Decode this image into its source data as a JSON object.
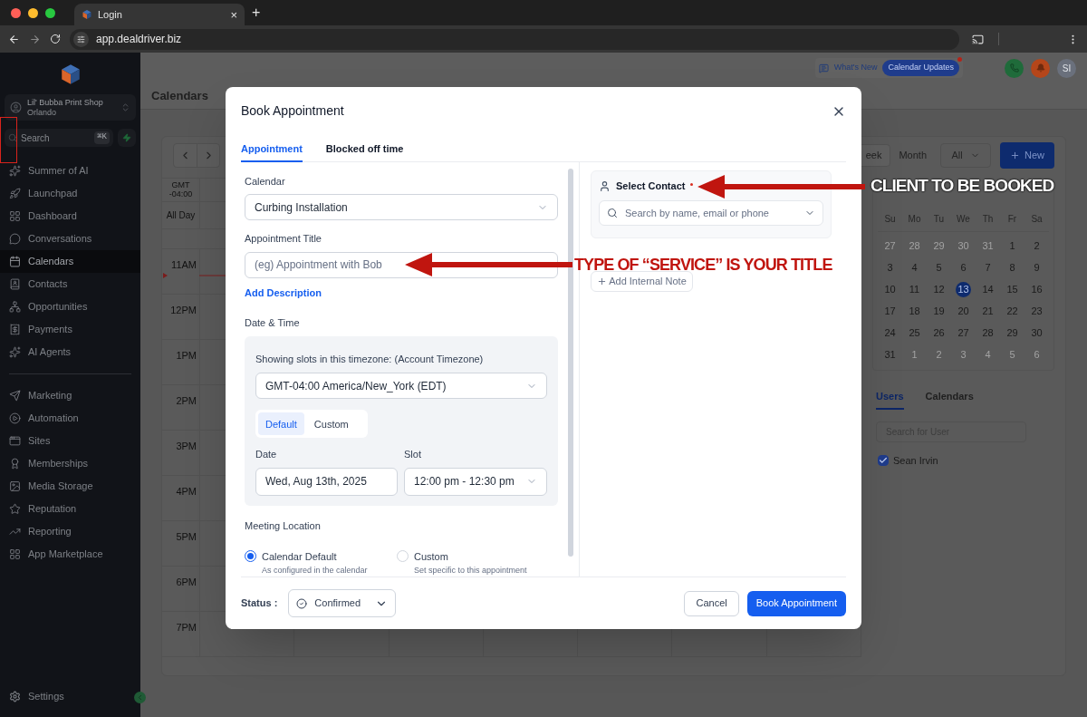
{
  "browser": {
    "tab_title": "Login",
    "tab_close": "×",
    "new_tab": "+",
    "url": "app.dealdriver.biz"
  },
  "sidebar": {
    "account": {
      "name": "Lil' Bubba Print Shop",
      "location": "Orlando"
    },
    "search": {
      "placeholder": "Search",
      "shortcut": "⌘K"
    },
    "items": [
      {
        "label": "Summer of AI",
        "selected": false
      },
      {
        "label": "Launchpad",
        "selected": false
      },
      {
        "label": "Dashboard",
        "selected": false
      },
      {
        "label": "Conversations",
        "selected": false
      },
      {
        "label": "Calendars",
        "selected": true
      },
      {
        "label": "Contacts",
        "selected": false
      },
      {
        "label": "Opportunities",
        "selected": false
      },
      {
        "label": "Payments",
        "selected": false
      },
      {
        "label": "AI Agents",
        "selected": false
      }
    ],
    "items_2": [
      {
        "label": "Marketing",
        "selected": false
      },
      {
        "label": "Automation",
        "selected": false
      },
      {
        "label": "Sites",
        "selected": false
      },
      {
        "label": "Memberships",
        "selected": false
      },
      {
        "label": "Media Storage",
        "selected": false
      },
      {
        "label": "Reputation",
        "selected": false
      },
      {
        "label": "Reporting",
        "selected": false
      },
      {
        "label": "App Marketplace",
        "selected": false
      }
    ],
    "settings": "Settings"
  },
  "header": {
    "whats_new": "What's New",
    "badge": "Calendar Updates",
    "badge_unread": true,
    "avatar": "SI"
  },
  "page": {
    "title": "Calendars"
  },
  "toolbar": {
    "views": [
      {
        "label": "eek",
        "selected": true
      },
      {
        "label": "Month",
        "selected": false
      }
    ],
    "filter": "All",
    "new_button": "New"
  },
  "grid": {
    "timezone": "GMT -04:00",
    "all_day": "All Day",
    "hours": [
      "11AM",
      "12PM",
      "1PM",
      "2PM",
      "3PM",
      "4PM",
      "5PM",
      "6PM",
      "7PM"
    ]
  },
  "mini_calendar": {
    "weekdays": [
      "Su",
      "Mo",
      "Tu",
      "We",
      "Th",
      "Fr",
      "Sa"
    ],
    "days": [
      {
        "label": "27",
        "muted": true,
        "selected": false
      },
      {
        "label": "28",
        "muted": true,
        "selected": false
      },
      {
        "label": "29",
        "muted": true,
        "selected": false
      },
      {
        "label": "30",
        "muted": true,
        "selected": false
      },
      {
        "label": "31",
        "muted": true,
        "selected": false
      },
      {
        "label": "1",
        "muted": false,
        "selected": false
      },
      {
        "label": "2",
        "muted": false,
        "selected": false
      },
      {
        "label": "3",
        "muted": false,
        "selected": false
      },
      {
        "label": "4",
        "muted": false,
        "selected": false
      },
      {
        "label": "5",
        "muted": false,
        "selected": false
      },
      {
        "label": "6",
        "muted": false,
        "selected": false
      },
      {
        "label": "7",
        "muted": false,
        "selected": false
      },
      {
        "label": "8",
        "muted": false,
        "selected": false
      },
      {
        "label": "9",
        "muted": false,
        "selected": false
      },
      {
        "label": "10",
        "muted": false,
        "selected": false
      },
      {
        "label": "11",
        "muted": false,
        "selected": false
      },
      {
        "label": "12",
        "muted": false,
        "selected": false
      },
      {
        "label": "13",
        "muted": false,
        "selected": true
      },
      {
        "label": "14",
        "muted": false,
        "selected": false
      },
      {
        "label": "15",
        "muted": false,
        "selected": false
      },
      {
        "label": "16",
        "muted": false,
        "selected": false
      },
      {
        "label": "17",
        "muted": false,
        "selected": false
      },
      {
        "label": "18",
        "muted": false,
        "selected": false
      },
      {
        "label": "19",
        "muted": false,
        "selected": false
      },
      {
        "label": "20",
        "muted": false,
        "selected": false
      },
      {
        "label": "21",
        "muted": false,
        "selected": false
      },
      {
        "label": "22",
        "muted": false,
        "selected": false
      },
      {
        "label": "23",
        "muted": false,
        "selected": false
      },
      {
        "label": "24",
        "muted": false,
        "selected": false
      },
      {
        "label": "25",
        "muted": false,
        "selected": false
      },
      {
        "label": "26",
        "muted": false,
        "selected": false
      },
      {
        "label": "27",
        "muted": false,
        "selected": false
      },
      {
        "label": "28",
        "muted": false,
        "selected": false
      },
      {
        "label": "29",
        "muted": false,
        "selected": false
      },
      {
        "label": "30",
        "muted": false,
        "selected": false
      },
      {
        "label": "31",
        "muted": false,
        "selected": false
      },
      {
        "label": "1",
        "muted": true,
        "selected": false
      },
      {
        "label": "2",
        "muted": true,
        "selected": false
      },
      {
        "label": "3",
        "muted": true,
        "selected": false
      },
      {
        "label": "4",
        "muted": true,
        "selected": false
      },
      {
        "label": "5",
        "muted": true,
        "selected": false
      },
      {
        "label": "6",
        "muted": true,
        "selected": false
      }
    ]
  },
  "users_panel": {
    "tabs": [
      {
        "label": "Users",
        "selected": true
      },
      {
        "label": "Calendars",
        "selected": false
      }
    ],
    "search_placeholder": "Search for User",
    "users": [
      {
        "name": "Sean Irvin",
        "checked": true
      }
    ]
  },
  "modal": {
    "title": "Book Appointment",
    "tabs": [
      {
        "label": "Appointment",
        "selected": true
      },
      {
        "label": "Blocked off time",
        "selected": false
      }
    ],
    "calendar_label": "Calendar",
    "calendar_value": "Curbing Installation",
    "title_label": "Appointment Title",
    "title_placeholder": "(eg) Appointment with Bob",
    "add_description": "Add Description",
    "datetime_label": "Date & Time",
    "timezone_note": "Showing slots in this timezone: (Account Timezone)",
    "timezone_value": "GMT-04:00 America/New_York (EDT)",
    "slot_modes": [
      {
        "label": "Default",
        "selected": true
      },
      {
        "label": "Custom",
        "selected": false
      }
    ],
    "date_label": "Date",
    "date_value": "Wed, Aug 13th, 2025",
    "slot_label": "Slot",
    "slot_value": "12:00 pm - 12:30 pm",
    "location_label": "Meeting Location",
    "locations": [
      {
        "label": "Calendar Default",
        "hint": "As configured in the calendar",
        "selected": true
      },
      {
        "label": "Custom",
        "hint": "Set specific to this appointment",
        "selected": false
      }
    ],
    "contact_label": "Select Contact",
    "contact_required": true,
    "contact_placeholder": "Search by name, email or phone",
    "add_note": "Add Internal Note",
    "status_label": "Status :",
    "status_value": "Confirmed",
    "cancel": "Cancel",
    "submit": "Book Appointment"
  },
  "annotations": {
    "contact_callout": "CLIENT TO BE BOOKED",
    "title_callout": "TYPE OF “SERVICE” IS YOUR TITLE"
  }
}
